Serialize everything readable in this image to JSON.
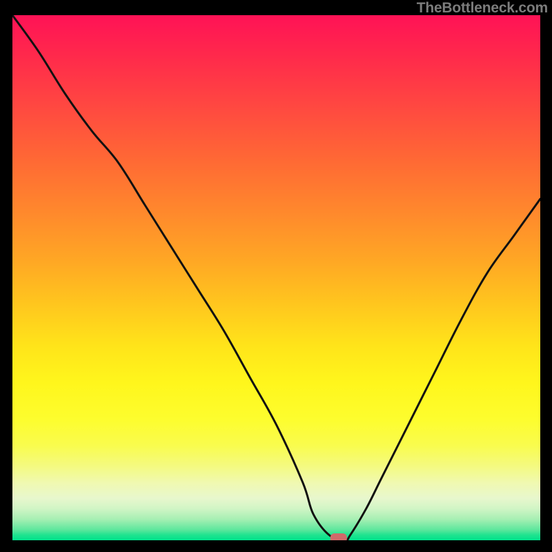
{
  "watermark": {
    "text": "TheBottleneck.com"
  },
  "chart_data": {
    "type": "line",
    "title": "",
    "xlabel": "",
    "ylabel": "",
    "xlim": [
      0,
      100
    ],
    "ylim": [
      0,
      100
    ],
    "grid": false,
    "legend": false,
    "marker": {
      "x": 61.8,
      "min_value": 0
    },
    "series": [
      {
        "name": "bottleneck-curve",
        "x": [
          0,
          5,
          10,
          15,
          20,
          25,
          30,
          35,
          40,
          45,
          50,
          55,
          57,
          60,
          63,
          64,
          67,
          70,
          75,
          80,
          85,
          90,
          95,
          100
        ],
        "values": [
          100,
          93,
          85,
          78,
          72,
          64,
          56,
          48,
          40,
          31,
          22,
          11,
          5,
          1,
          0,
          1,
          6,
          12,
          22,
          32,
          42,
          51,
          58,
          65
        ]
      }
    ]
  },
  "colors": {
    "background": "#000000",
    "curve": "#111111",
    "marker": "#d06a6a"
  }
}
